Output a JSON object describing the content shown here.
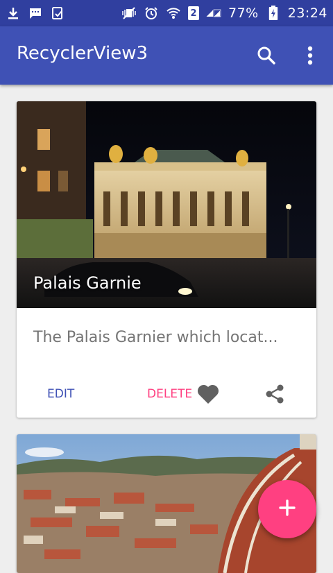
{
  "status_bar": {
    "battery_percent": "77%",
    "time": "23:24",
    "sim_slot": "2",
    "icons": [
      "download-icon",
      "message-icon",
      "clipboard-check-icon",
      "vibrate-off-icon",
      "alarm-icon",
      "wifi-icon",
      "signal-icon",
      "battery-charging-icon"
    ]
  },
  "app_bar": {
    "title": "RecyclerView3",
    "actions": [
      "search-icon",
      "more-vert-icon"
    ]
  },
  "cards": [
    {
      "title": "Palais Garnie",
      "description": "The Palais Garnier which locat...",
      "edit_label": "EDIT",
      "delete_label": "DELETE",
      "favorite_icon": "heart-icon",
      "share_icon": "share-icon"
    },
    {
      "title": "",
      "description": ""
    }
  ],
  "fab": {
    "icon": "add-icon"
  },
  "colors": {
    "primary": "#3f51b5",
    "primary_dark": "#303f9f",
    "accent": "#ff4081",
    "background": "#eeeeee"
  }
}
